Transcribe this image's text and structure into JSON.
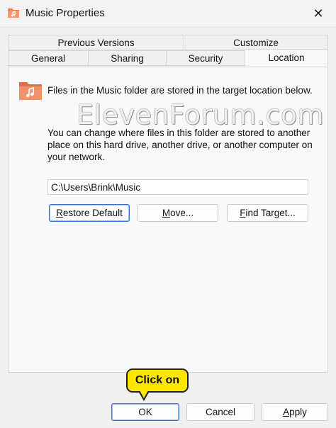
{
  "window": {
    "title": "Music Properties",
    "close_glyph": "✕"
  },
  "tabs_row1": [
    "Previous Versions",
    "Customize"
  ],
  "tabs_row2": [
    "General",
    "Sharing",
    "Security",
    "Location"
  ],
  "active_tab": "Location",
  "location": {
    "description1": "Files in the Music folder are stored in the target location below.",
    "description2": "You can change where files in this folder are stored to another place on this hard drive, another drive, or another computer on your network.",
    "path_value": "C:\\Users\\Brink\\Music",
    "buttons": {
      "restore_default": {
        "mnemonic": "R",
        "rest": "estore Default"
      },
      "move": {
        "mnemonic": "M",
        "rest": "ove..."
      },
      "find_target": {
        "mnemonic": "F",
        "rest": "ind Target..."
      }
    }
  },
  "watermark": "ElevenForum.com",
  "callout": "Click on",
  "dialog_buttons": {
    "ok": "OK",
    "cancel": "Cancel",
    "apply": {
      "mnemonic": "A",
      "rest": "pply"
    }
  },
  "icons": {
    "app": "music-folder-icon",
    "folder": "music-folder-icon",
    "close": "close-icon"
  },
  "colors": {
    "folder": "#e8805a",
    "callout": "#ffe600",
    "focus": "#3a6fd8"
  }
}
